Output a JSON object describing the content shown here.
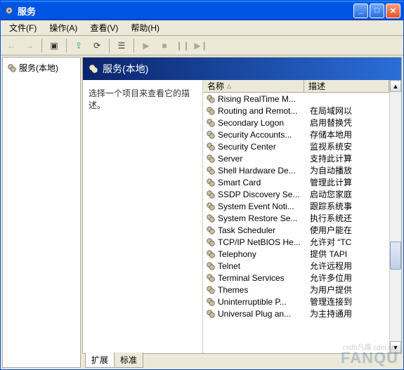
{
  "window": {
    "title": "服务"
  },
  "menu": {
    "file": "文件(F)",
    "action": "操作(A)",
    "view": "查看(V)",
    "help": "帮助(H)"
  },
  "tree": {
    "root": "服务(本地)"
  },
  "detail": {
    "header": "服务(本地)",
    "prompt": "选择一个项目来查看它的描述。"
  },
  "columns": {
    "name": "名称",
    "desc": "描述"
  },
  "tabs": {
    "extended": "扩展",
    "standard": "标准"
  },
  "services": [
    {
      "name": "Rising RealTime M...",
      "desc": ""
    },
    {
      "name": "Routing and Remot...",
      "desc": "在局域网以"
    },
    {
      "name": "Secondary Logon",
      "desc": "启用替换凭"
    },
    {
      "name": "Security Accounts...",
      "desc": "存储本地用"
    },
    {
      "name": "Security Center",
      "desc": "监视系统安"
    },
    {
      "name": "Server",
      "desc": "支持此计算"
    },
    {
      "name": "Shell Hardware De...",
      "desc": "为自动播放"
    },
    {
      "name": "Smart Card",
      "desc": "管理此计算"
    },
    {
      "name": "SSDP Discovery Se...",
      "desc": "启动您家庭"
    },
    {
      "name": "System Event Noti...",
      "desc": "跟踪系统事"
    },
    {
      "name": "System Restore Se...",
      "desc": "执行系统还"
    },
    {
      "name": "Task Scheduler",
      "desc": "使用户能在"
    },
    {
      "name": "TCP/IP NetBIOS He...",
      "desc": "允许对 “TC"
    },
    {
      "name": "Telephony",
      "desc": "提供 TAPI "
    },
    {
      "name": "Telnet",
      "desc": "允许远程用"
    },
    {
      "name": "Terminal Services",
      "desc": "允许多位用"
    },
    {
      "name": "Themes",
      "desc": "为用户提供"
    },
    {
      "name": "Uninterruptible P...",
      "desc": "管理连接到"
    },
    {
      "name": "Universal Plug an...",
      "desc": "为主持通用"
    }
  ],
  "watermark": "FANQU",
  "watermark2": "csdb凡趣 cdei.cn"
}
